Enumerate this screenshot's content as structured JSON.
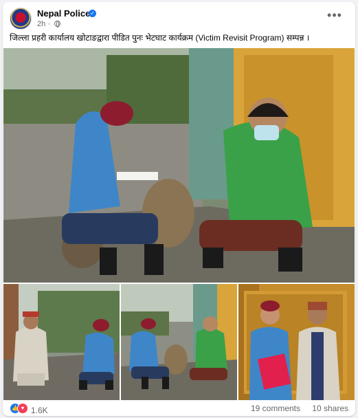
{
  "post": {
    "page_name": "Nepal Police",
    "timestamp": "2h",
    "caption": "जिल्ला प्रहरी कार्यालय खोटाङद्वारा पीडित पुनः भेटघाट कार्यक्रम (Victim Revisit Program) सम्पन्न ।",
    "icons": {
      "verified": "verified-badge-icon",
      "audience": "globe-icon",
      "more": "more-options-icon"
    }
  },
  "footer": {
    "reaction_count": "1.6K",
    "comments": "19 comments",
    "shares": "10 shares"
  },
  "colors": {
    "brand_blue": "#1877f2",
    "love_red": "#f33e58",
    "muted_text": "#65676b"
  }
}
